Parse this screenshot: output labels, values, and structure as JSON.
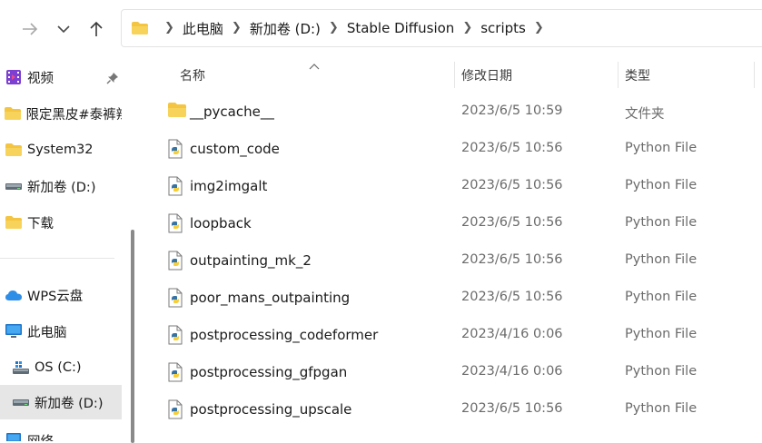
{
  "nav_buttons": {
    "forward_icon": "arrow-right-icon",
    "recent_icon": "chevron-down-icon",
    "up_icon": "arrow-up-icon"
  },
  "address_bar": {
    "crumbs": [
      "此电脑",
      "新加卷 (D:)",
      "Stable Diffusion",
      "scripts"
    ]
  },
  "sidebar": {
    "items": [
      {
        "label": "视频",
        "icon": "video-folder-icon",
        "pinned": true
      },
      {
        "label": "限定黑皮#泰裤辣",
        "icon": "folder-icon"
      },
      {
        "label": "System32",
        "icon": "folder-icon"
      },
      {
        "label": "新加卷 (D:)",
        "icon": "drive-icon"
      },
      {
        "label": "下载",
        "icon": "folder-icon"
      },
      {
        "label": "WPS云盘",
        "icon": "cloud-icon"
      },
      {
        "label": "此电脑",
        "icon": "computer-icon"
      },
      {
        "label": "OS (C:)",
        "icon": "drive-icon"
      },
      {
        "label": "新加卷 (D:)",
        "icon": "drive-icon",
        "selected": true
      },
      {
        "label": "网络",
        "icon": "network-icon"
      }
    ]
  },
  "columns": {
    "name": "名称",
    "modified": "修改日期",
    "type": "类型"
  },
  "files": [
    {
      "name": "__pycache__",
      "modified": "2023/6/5 10:59",
      "type": "文件夹",
      "icon": "folder-icon"
    },
    {
      "name": "custom_code",
      "modified": "2023/6/5 10:56",
      "type": "Python File",
      "icon": "python-file-icon"
    },
    {
      "name": "img2imgalt",
      "modified": "2023/6/5 10:56",
      "type": "Python File",
      "icon": "python-file-icon"
    },
    {
      "name": "loopback",
      "modified": "2023/6/5 10:56",
      "type": "Python File",
      "icon": "python-file-icon"
    },
    {
      "name": "outpainting_mk_2",
      "modified": "2023/6/5 10:56",
      "type": "Python File",
      "icon": "python-file-icon"
    },
    {
      "name": "poor_mans_outpainting",
      "modified": "2023/6/5 10:56",
      "type": "Python File",
      "icon": "python-file-icon"
    },
    {
      "name": "postprocessing_codeformer",
      "modified": "2023/4/16 0:06",
      "type": "Python File",
      "icon": "python-file-icon"
    },
    {
      "name": "postprocessing_gfpgan",
      "modified": "2023/4/16 0:06",
      "type": "Python File",
      "icon": "python-file-icon"
    },
    {
      "name": "postprocessing_upscale",
      "modified": "2023/6/5 10:56",
      "type": "Python File",
      "icon": "python-file-icon"
    }
  ],
  "colors": {
    "folder": "#f4c542",
    "selection": "#e6e6e6",
    "python_blue": "#3572a5",
    "python_yellow": "#f7cf3c"
  }
}
